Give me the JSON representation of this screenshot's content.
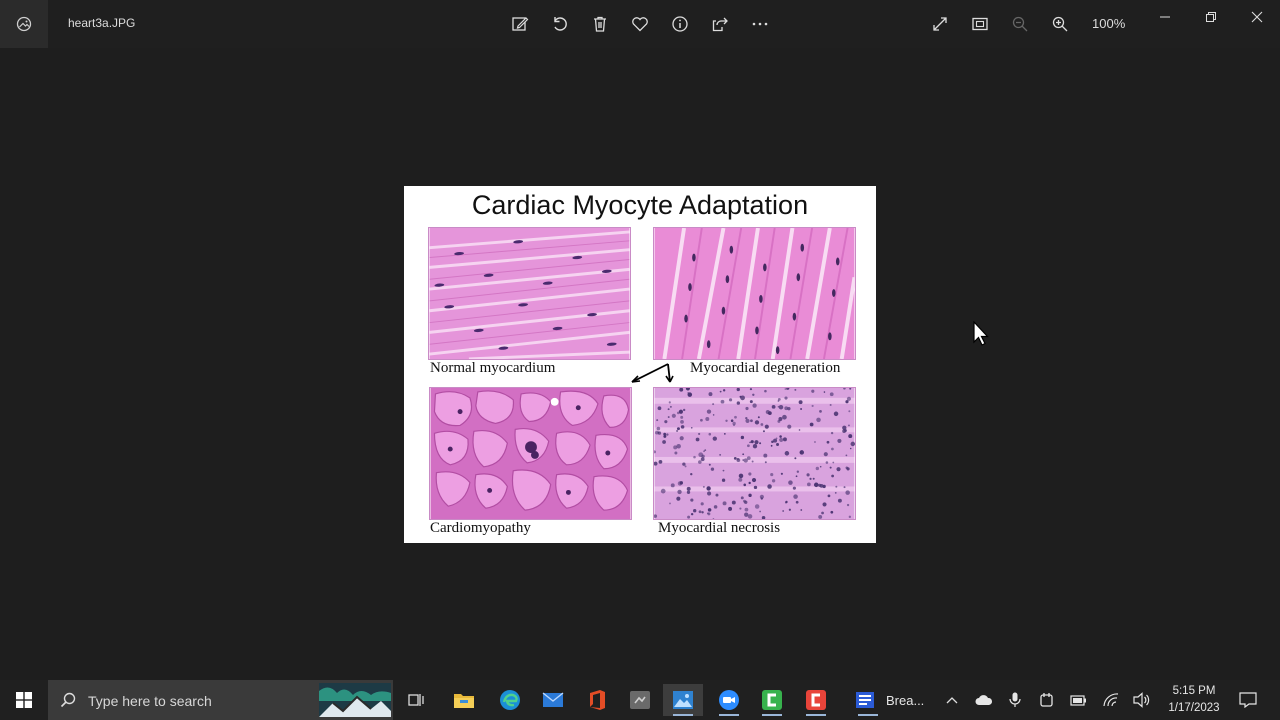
{
  "window": {
    "filename": "heart3a.JPG",
    "zoom": "100%"
  },
  "image": {
    "title": "Cardiac Myocyte Adaptation",
    "panels": [
      {
        "caption": "Normal myocardium"
      },
      {
        "caption": "Myocardial degeneration"
      },
      {
        "caption": "Cardiomyopathy"
      },
      {
        "caption": "Myocardial necrosis"
      }
    ]
  },
  "taskbar": {
    "search_placeholder": "Type here to search",
    "word_label": "Brea...",
    "time": "5:15 PM",
    "date": "1/17/2023"
  },
  "colors": {
    "background": "#1e1e1e",
    "taskbar": "#202020",
    "tissue_pink": "#e58fd8",
    "nucleus_purple": "#4a2a6e"
  }
}
